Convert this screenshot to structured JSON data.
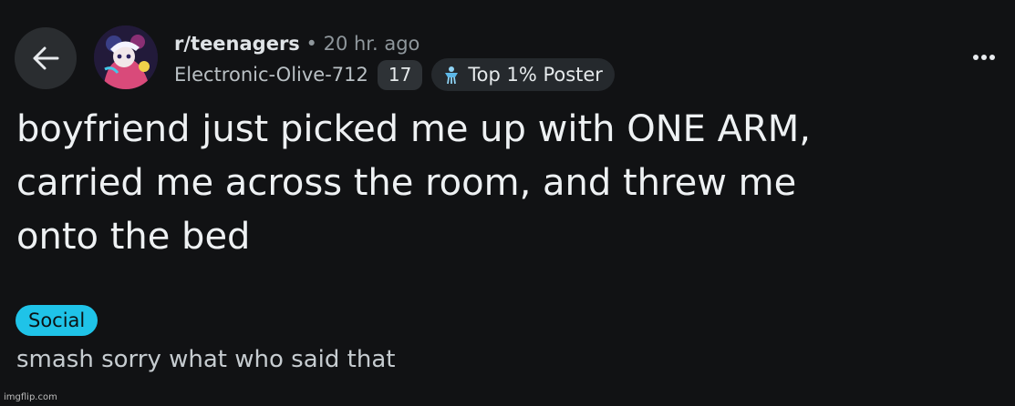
{
  "header": {
    "subreddit": "r/teenagers",
    "separator": "•",
    "time_ago": "20 hr. ago",
    "username": "Electronic-Olive-712",
    "flair_count": "17",
    "flair_badge": "Top 1% Poster"
  },
  "post": {
    "title_lines": [
      "boyfriend just picked me up with ONE ARM,",
      "carried me across the room, and threw me",
      "onto the bed"
    ],
    "tag": "Social",
    "body": "smash sorry what who said that"
  },
  "watermark": "imgflip.com",
  "icons": {
    "back": "arrow-left-icon",
    "more": "more-horizontal-icon",
    "badge": "top-poster-icon"
  },
  "colors": {
    "background": "#111214",
    "tag": "#1fc3e8"
  }
}
